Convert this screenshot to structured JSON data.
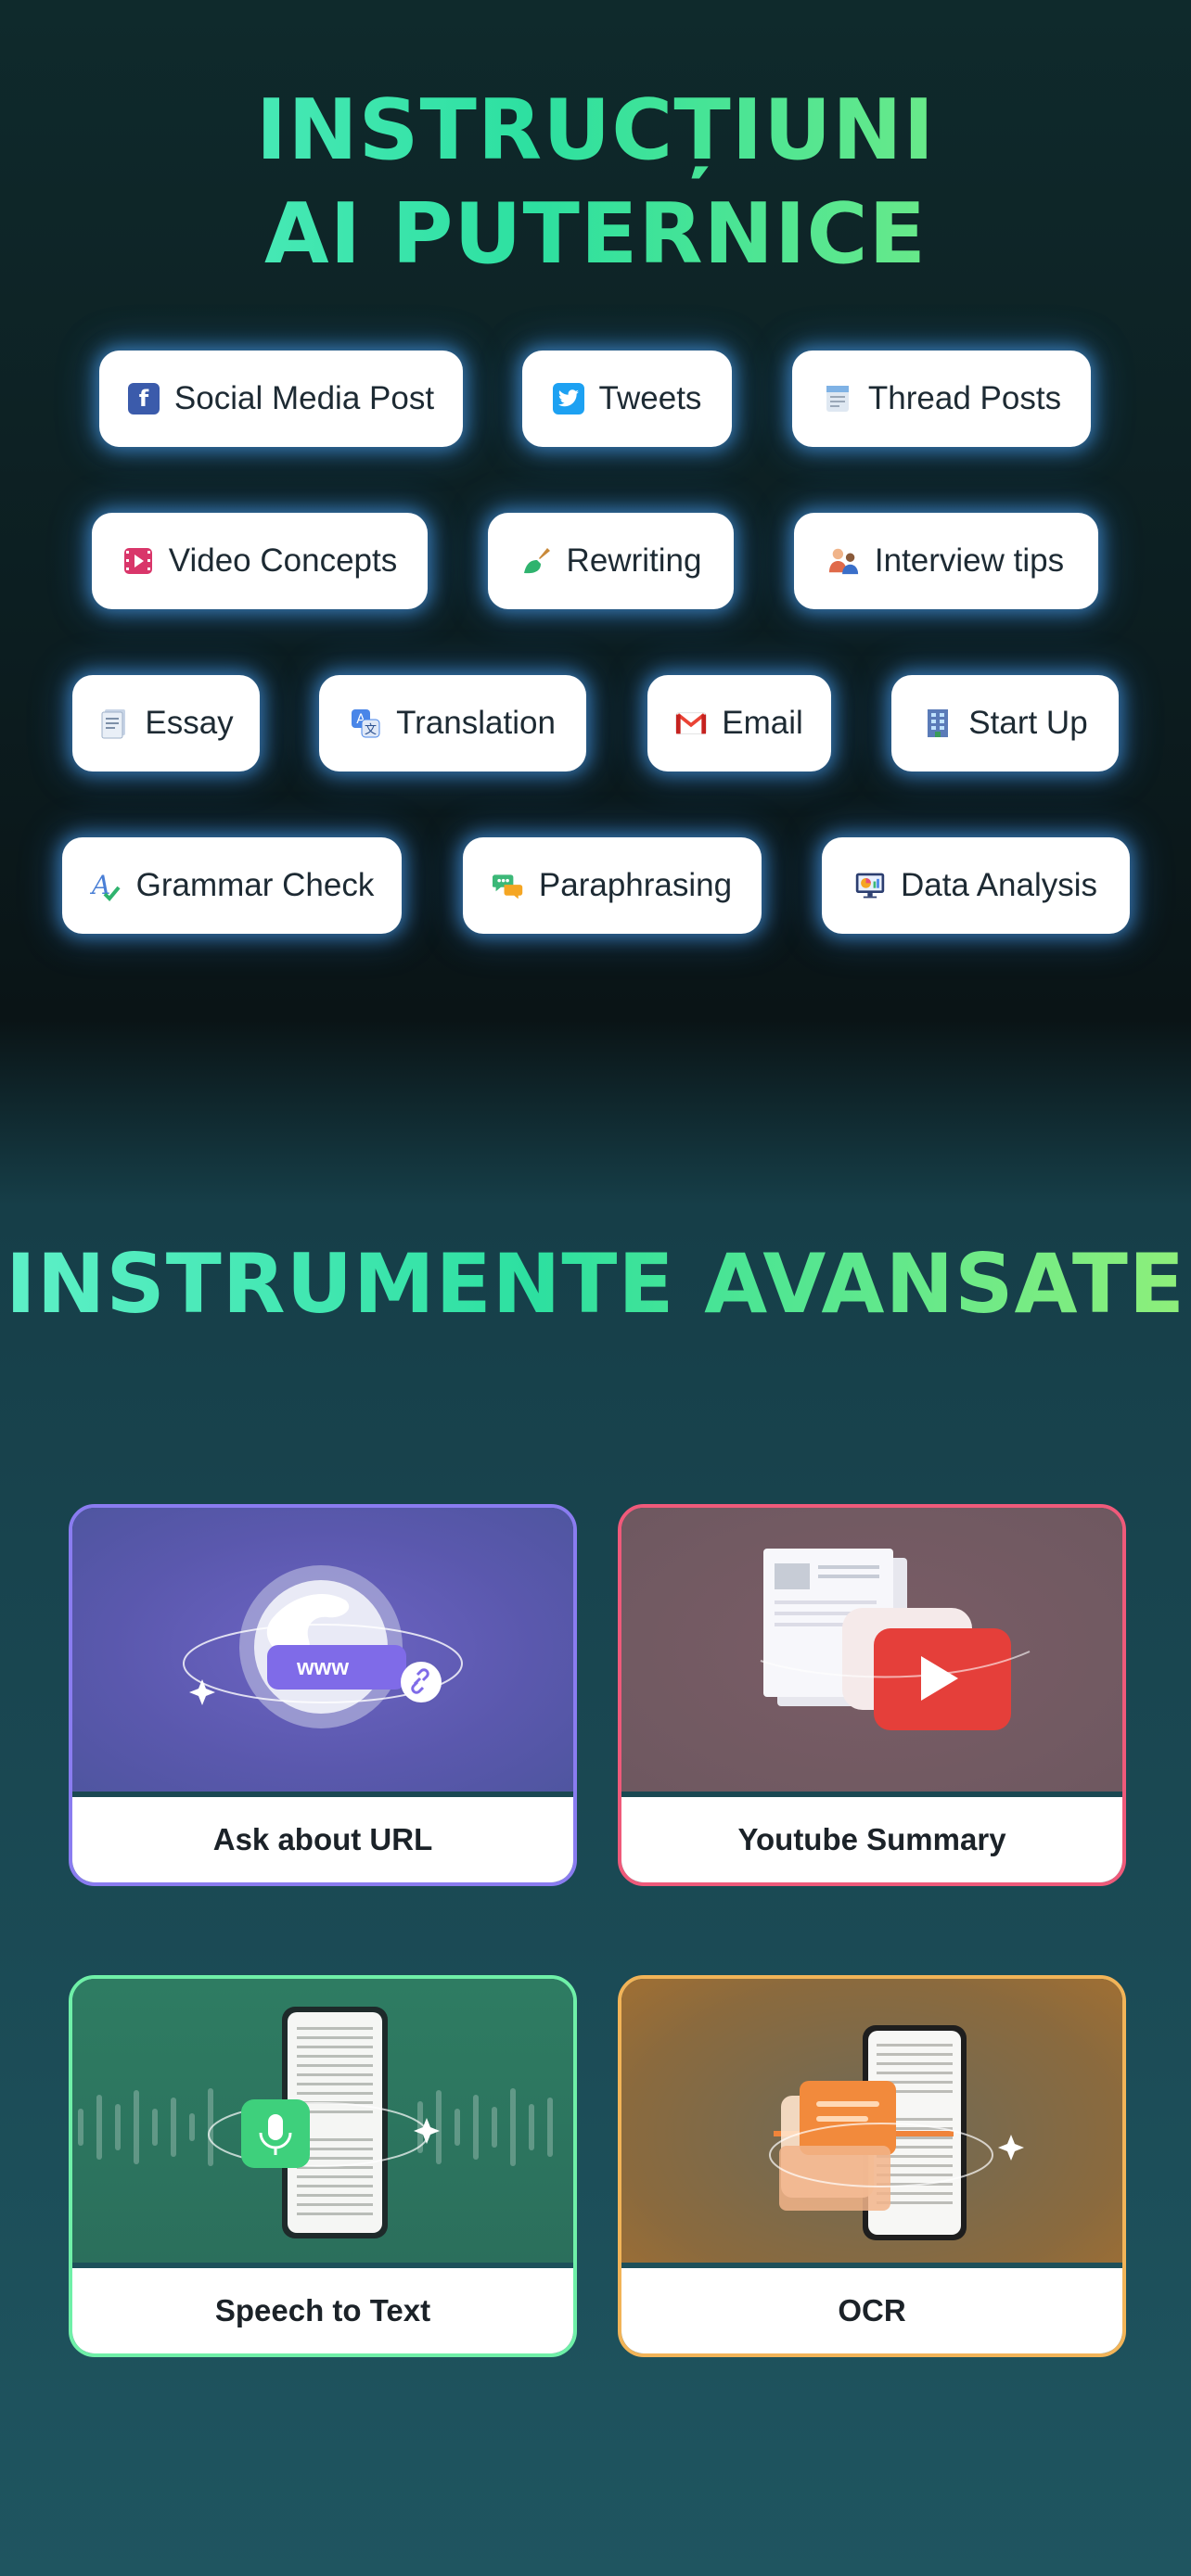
{
  "section1": {
    "title_line1": "INSTRUCȚIUNI",
    "title_line2": "AI PUTERNICE",
    "chips": [
      {
        "label": "Social Media Post",
        "icon": "facebook-icon"
      },
      {
        "label": "Tweets",
        "icon": "twitter-icon"
      },
      {
        "label": "Thread Posts",
        "icon": "notepad-icon"
      },
      {
        "label": "Video Concepts",
        "icon": "film-play-icon"
      },
      {
        "label": "Rewriting",
        "icon": "brush-icon"
      },
      {
        "label": "Interview tips",
        "icon": "people-icon"
      },
      {
        "label": "Essay",
        "icon": "document-icon"
      },
      {
        "label": "Translation",
        "icon": "translate-icon"
      },
      {
        "label": "Email",
        "icon": "gmail-icon"
      },
      {
        "label": "Start Up",
        "icon": "building-icon"
      },
      {
        "label": "Grammar Check",
        "icon": "grammar-icon"
      },
      {
        "label": "Paraphrasing",
        "icon": "speech-bubbles-icon"
      },
      {
        "label": "Data Analysis",
        "icon": "chart-monitor-icon"
      }
    ]
  },
  "section2": {
    "title": "INSTRUMENTE AVANSATE",
    "cards": [
      {
        "label": "Ask about URL",
        "badge": "www",
        "accent": "#8a7cf0"
      },
      {
        "label": "Youtube Summary",
        "accent": "#ef5a7a"
      },
      {
        "label": "Speech to Text",
        "accent": "#6ff0a8"
      },
      {
        "label": "OCR",
        "accent": "#f2b458"
      }
    ]
  }
}
